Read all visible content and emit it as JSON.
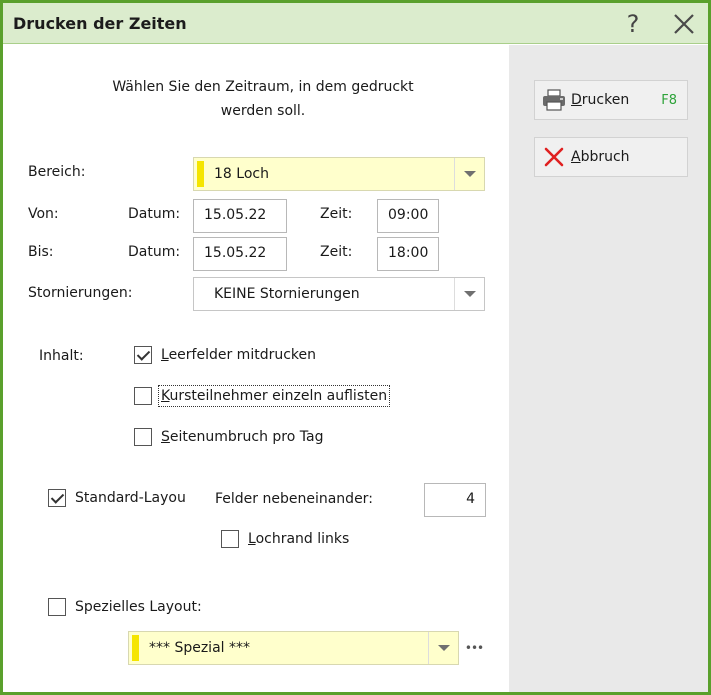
{
  "window": {
    "title": "Drucken der Zeiten"
  },
  "intro": {
    "line1": "Wählen Sie den Zeitraum, in dem gedruckt",
    "line2": "werden soll."
  },
  "form": {
    "bereich_label": "Bereich:",
    "bereich_value": "18 Loch",
    "von_label": "Von:",
    "bis_label": "Bis:",
    "datum_label": "Datum:",
    "zeit_label": "Zeit:",
    "von_datum": "15.05.22",
    "von_zeit": "09:00",
    "bis_datum": "15.05.22",
    "bis_zeit": "18:00",
    "storno_label": "Stornierungen:",
    "storno_value": "KEINE Stornierungen",
    "inhalt_label": "Inhalt:"
  },
  "options": {
    "leerfelder": {
      "first": "L",
      "rest": "eerfelder mitdrucken",
      "checked": true
    },
    "kursteilnehmer": {
      "first": "K",
      "rest": "ursteilnehmer einzeln auflisten",
      "checked": false
    },
    "seitenumbruch": {
      "first": "S",
      "rest": "eitenumbruch pro Tag",
      "checked": false
    },
    "standard_layout": {
      "label": "Standard-Layou",
      "checked": true
    },
    "felder_label": "Felder nebeneinander:",
    "felder_value": "4",
    "lochrand": {
      "first": "L",
      "rest": "ochrand links",
      "checked": false
    },
    "spezielles": {
      "label": "Spezielles Layout:",
      "checked": false
    },
    "spezial_value": "*** Spezial ***"
  },
  "buttons": {
    "drucken": {
      "first": "D",
      "rest": "rucken",
      "key": "F8"
    },
    "abbruch": {
      "first": "A",
      "rest": "bbruch"
    }
  },
  "colors": {
    "accent": "#5aa02c",
    "titlebar": "#dbeccd",
    "highlight_field": "#ffffcc",
    "marker": "#f5e500",
    "shortcut": "#2ea33a",
    "cancel": "#e02020"
  }
}
